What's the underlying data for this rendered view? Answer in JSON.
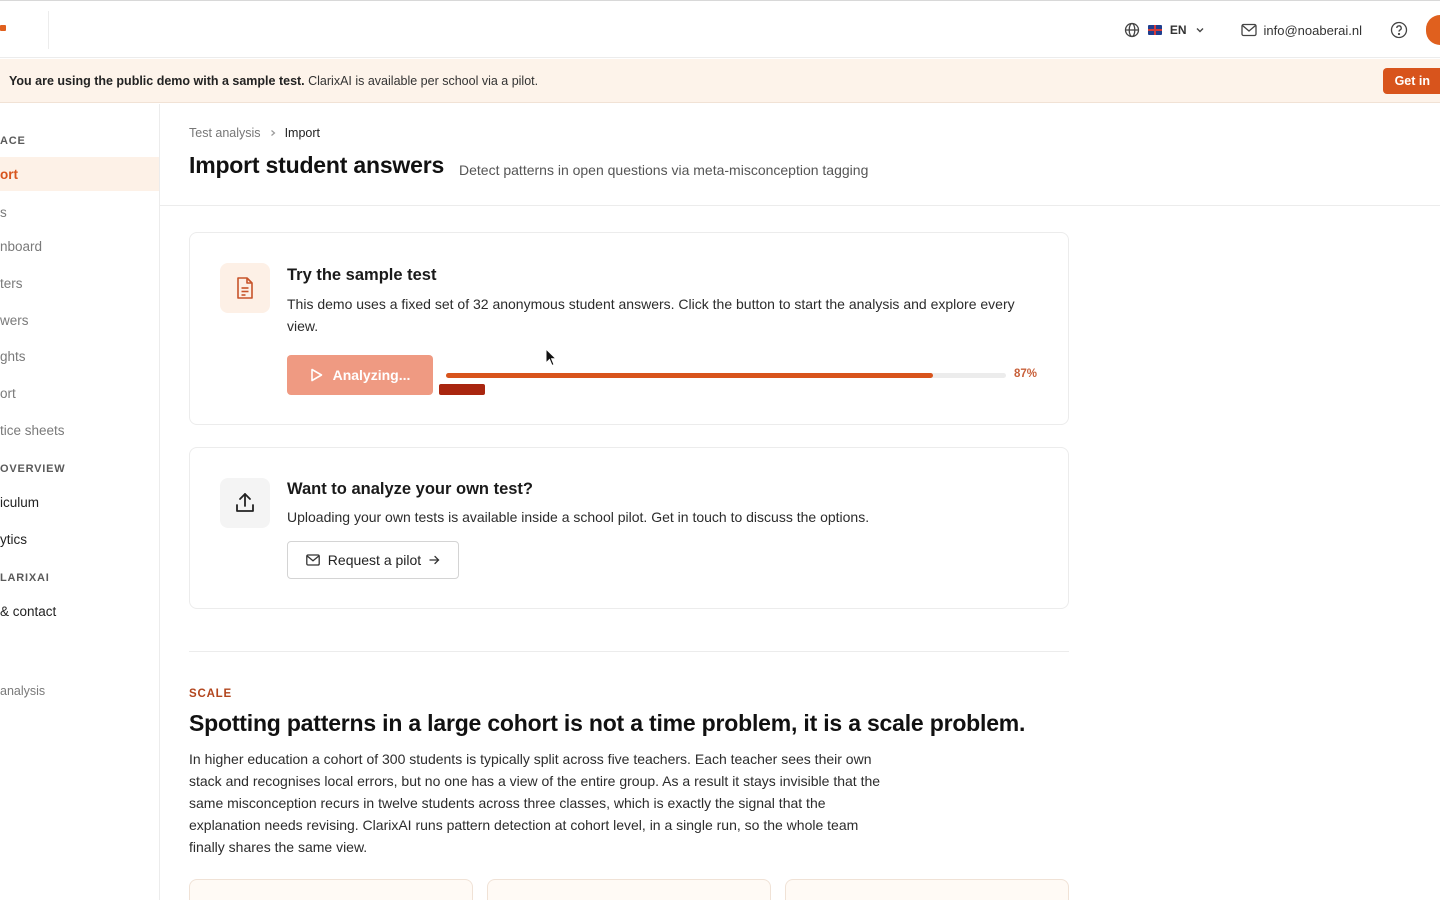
{
  "topbar": {
    "language": "EN",
    "email": "info@noaberai.nl",
    "icons": {
      "language": "globe-icon",
      "flag": "uk-flag-icon",
      "language_chevron": "chevron-down-icon",
      "email": "mail-icon",
      "help": "help-circle-icon"
    }
  },
  "banner": {
    "strong": "You are using the public demo with a sample test.",
    "text": " ClarixAI is available per school via a pilot.",
    "cta": "Get in"
  },
  "sidebar": {
    "sections": [
      {
        "label": "ACE"
      },
      {
        "label": "OVERVIEW"
      },
      {
        "label": "LARIXAI"
      }
    ],
    "items": [
      {
        "label": "ort"
      },
      {
        "label": "s"
      },
      {
        "label": "nboard"
      },
      {
        "label": "ters"
      },
      {
        "label": "wers"
      },
      {
        "label": "ghts"
      },
      {
        "label": "ort"
      },
      {
        "label": "tice sheets"
      },
      {
        "label": "iculum"
      },
      {
        "label": "ytics"
      },
      {
        "label": " & contact"
      },
      {
        "label": "analysis"
      }
    ]
  },
  "breadcrumb": {
    "parent": "Test analysis",
    "current": "Import"
  },
  "page": {
    "title": "Import student answers",
    "subtitle": "Detect patterns in open questions via meta-misconception tagging"
  },
  "sample_card": {
    "icon": "document-icon",
    "title": "Try the sample test",
    "text": "This demo uses a fixed set of 32 anonymous student answers. Click the button to start the analysis and explore every view.",
    "button": "Analyzing...",
    "button_icon": "play-icon",
    "progress_percent": 87,
    "progress_label": "87%",
    "accent": "#d8541c"
  },
  "own_test_card": {
    "icon": "upload-icon",
    "title": "Want to analyze your own test?",
    "text": "Uploading your own tests is available inside a school pilot. Get in touch to discuss the options.",
    "button": "Request a pilot",
    "button_icon": "mail-icon",
    "button_arrow": "arrow-right-icon"
  },
  "scale": {
    "eyebrow": "SCALE",
    "title": "Spotting patterns in a large cohort is not a time problem, it is a scale problem.",
    "body": "In higher education a cohort of 300 students is typically split across five teachers. Each teacher sees their own stack and recognises local errors, but no one has a view of the entire group. As a result it stays invisible that the same misconception recurs in twelve students across three classes, which is exactly the signal that the explanation needs revising. ClarixAI runs pattern detection at cohort level, in a single run, so the whole team finally shares the same view."
  }
}
